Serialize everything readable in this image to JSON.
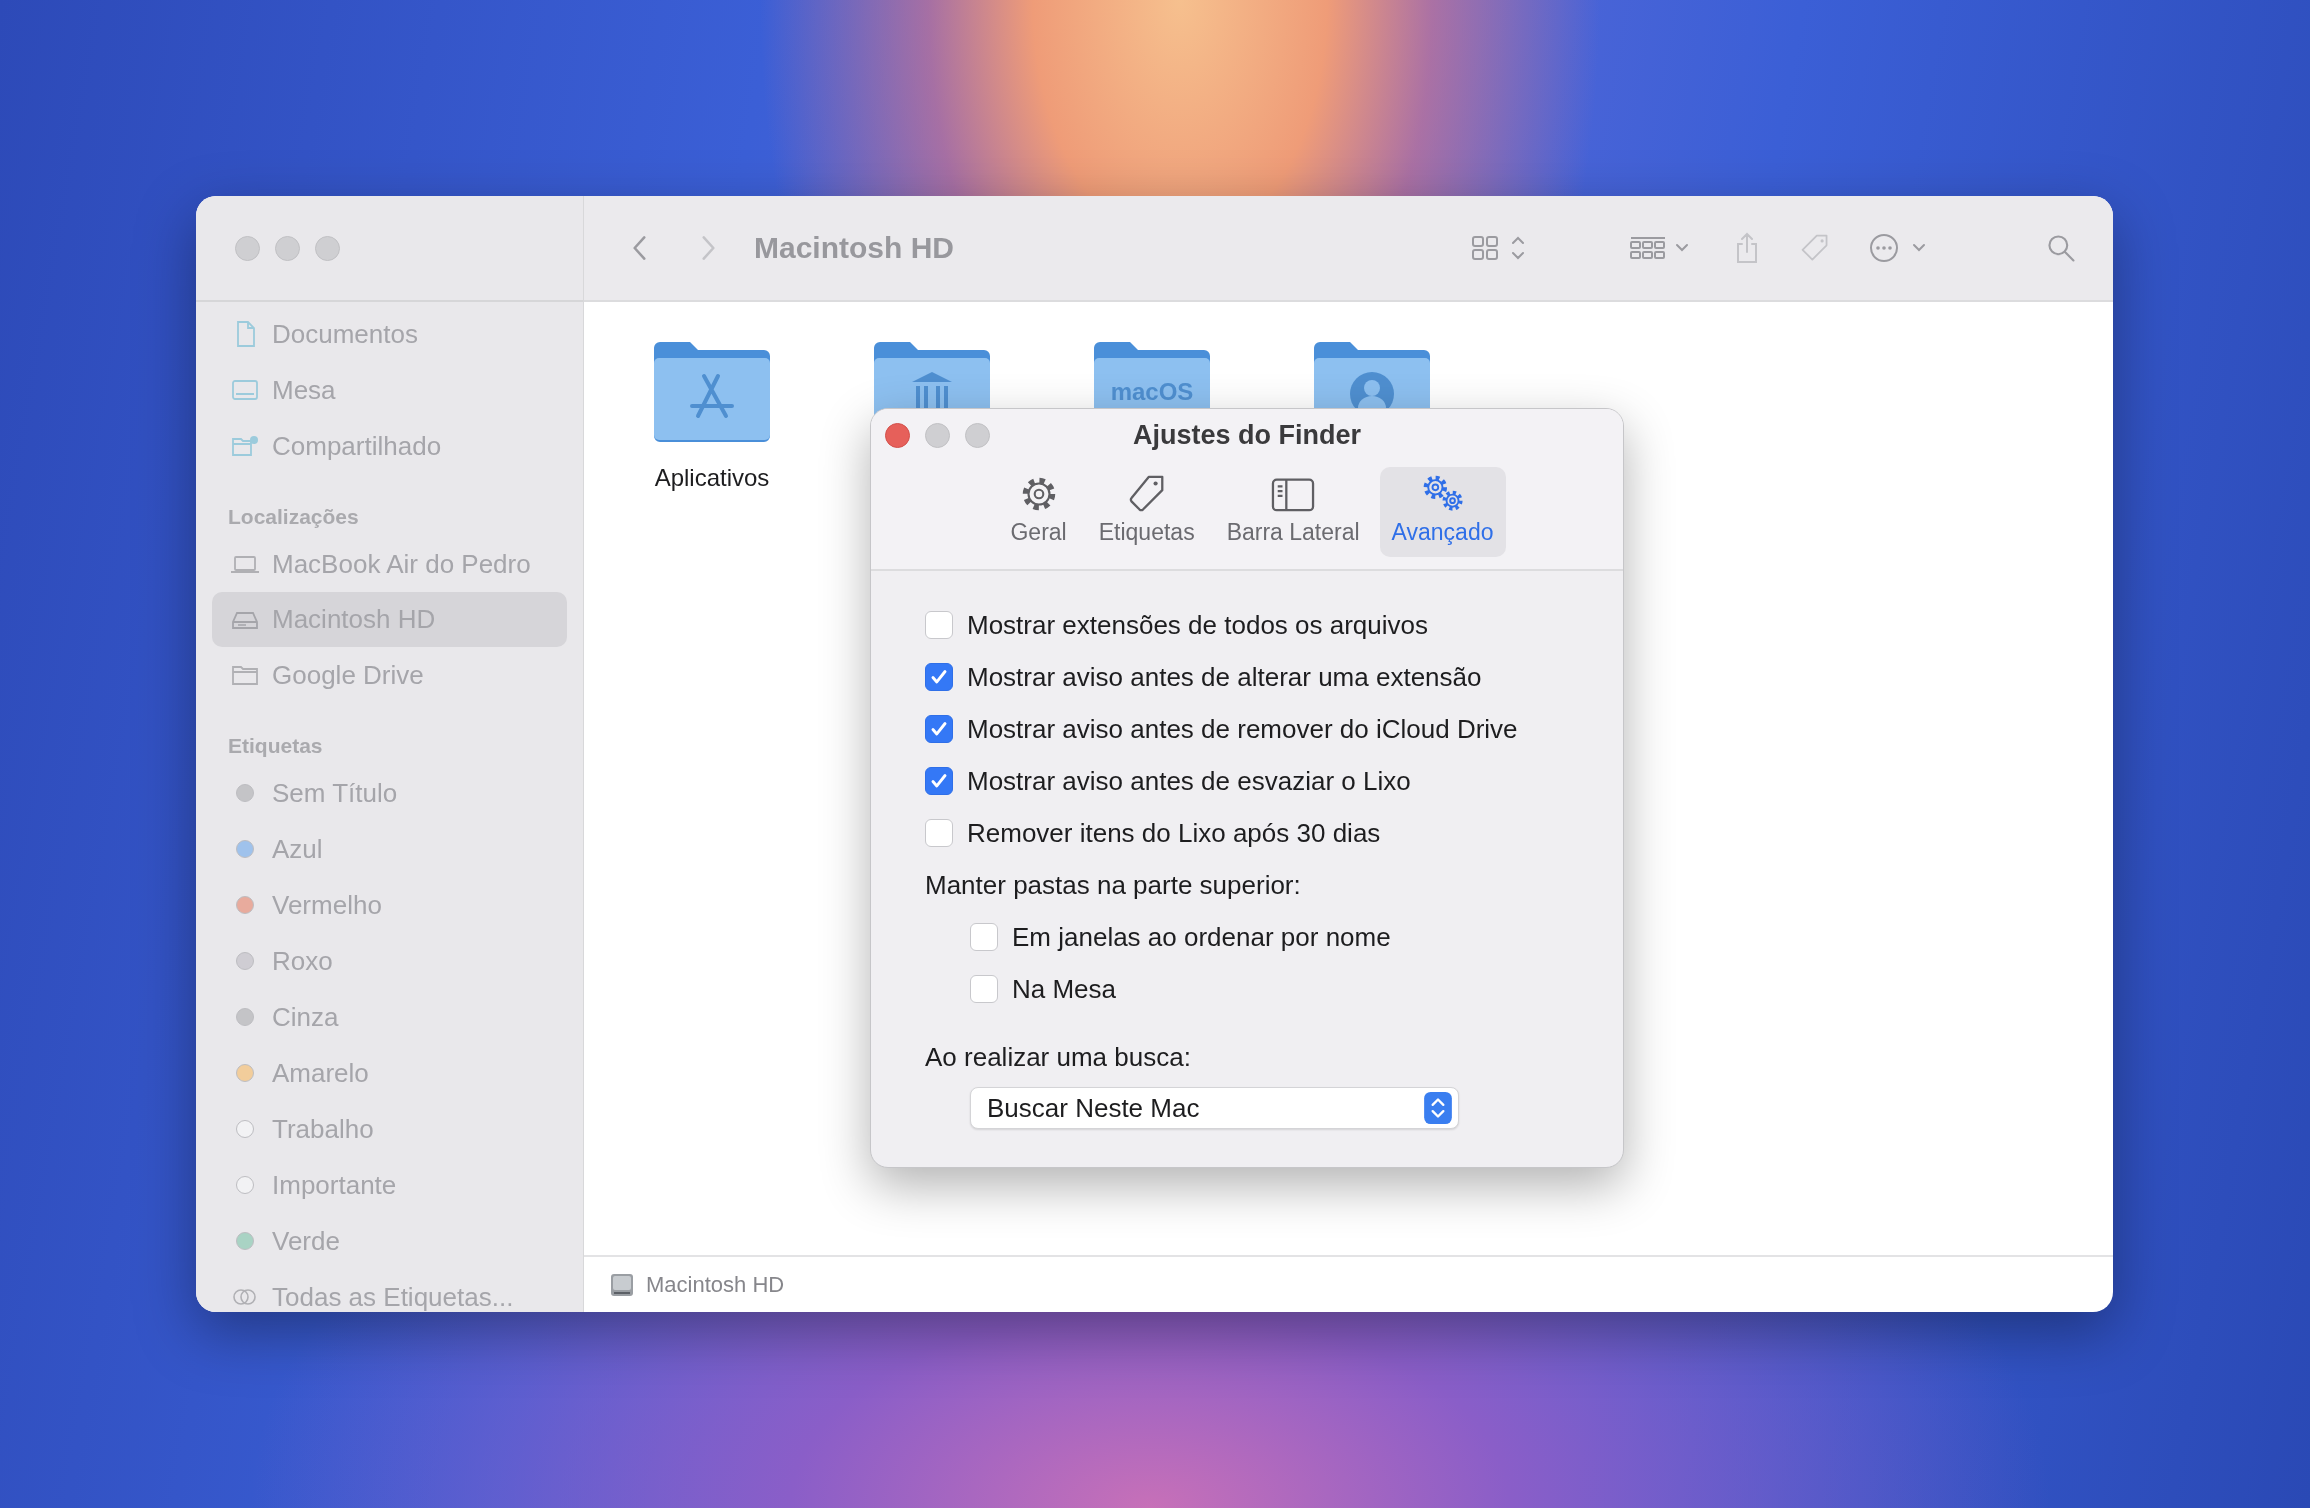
{
  "window": {
    "title": "Macintosh HD"
  },
  "sidebar": {
    "sections": [
      {
        "items": [
          {
            "kind": "document",
            "label": "Documentos",
            "selected": false
          },
          {
            "kind": "desktop",
            "label": "Mesa",
            "selected": false
          },
          {
            "kind": "shared",
            "label": "Compartilhado",
            "selected": false
          }
        ]
      },
      {
        "heading": "Localizações",
        "items": [
          {
            "kind": "laptop",
            "label": "MacBook Air do Pedro",
            "selected": false
          },
          {
            "kind": "drive",
            "label": "Macintosh HD",
            "selected": true
          },
          {
            "kind": "folder",
            "label": "Google Drive",
            "selected": false
          }
        ]
      },
      {
        "heading": "Etiquetas",
        "items": [
          {
            "kind": "tag",
            "label": "Sem Título",
            "color": "#c4c4c7",
            "selected": false
          },
          {
            "kind": "tag",
            "label": "Azul",
            "color": "#9fc2ec",
            "selected": false
          },
          {
            "kind": "tag",
            "label": "Vermelho",
            "color": "#e8ab9d",
            "selected": false
          },
          {
            "kind": "tag",
            "label": "Roxo",
            "color": "#cfcdd3",
            "selected": false
          },
          {
            "kind": "tag",
            "label": "Cinza",
            "color": "#c4c4c7",
            "selected": false
          },
          {
            "kind": "tag",
            "label": "Amarelo",
            "color": "#f2cd9b",
            "selected": false
          },
          {
            "kind": "tag",
            "label": "Trabalho",
            "color": "#f2f2f4",
            "selected": false
          },
          {
            "kind": "tag",
            "label": "Importante",
            "color": "#f2f2f4",
            "selected": false
          },
          {
            "kind": "tag",
            "label": "Verde",
            "color": "#a9d3c4",
            "selected": false
          },
          {
            "kind": "all-tags",
            "label": "Todas as Etiquetas...",
            "selected": false
          }
        ]
      }
    ]
  },
  "folders": [
    {
      "kind": "apps",
      "name": "Aplicativos"
    },
    {
      "kind": "library"
    },
    {
      "kind": "text",
      "text": "macOS"
    },
    {
      "kind": "user"
    }
  ],
  "status_bar": {
    "path": "Macintosh HD"
  },
  "dialog": {
    "title": "Ajustes do Finder",
    "tabs": [
      {
        "kind": "gear",
        "label": "Geral",
        "selected": false
      },
      {
        "kind": "tag",
        "label": "Etiquetas",
        "selected": false
      },
      {
        "kind": "sidebar",
        "label": "Barra Lateral",
        "selected": false
      },
      {
        "kind": "gears",
        "label": "Avançado",
        "selected": true
      }
    ],
    "options": [
      {
        "kind": "checkbox",
        "label": "Mostrar extensões de todos os arquivos",
        "checked": false
      },
      {
        "kind": "checkbox",
        "label": "Mostrar aviso antes de alterar uma extensão",
        "checked": true
      },
      {
        "kind": "checkbox",
        "label": "Mostrar aviso antes de remover do iCloud Drive",
        "checked": true
      },
      {
        "kind": "checkbox",
        "label": "Mostrar aviso antes de esvaziar o Lixo",
        "checked": true
      },
      {
        "kind": "checkbox",
        "label": "Remover itens do Lixo após 30 dias",
        "checked": false
      },
      {
        "kind": "group",
        "label": "Manter pastas na parte superior:",
        "children": [
          {
            "kind": "checkbox",
            "label": "Em janelas ao ordenar por nome",
            "checked": false
          },
          {
            "kind": "checkbox",
            "label": "Na Mesa",
            "checked": false
          }
        ]
      },
      {
        "kind": "select",
        "label": "Ao realizar uma busca:",
        "value": "Buscar Neste Mac"
      }
    ]
  }
}
